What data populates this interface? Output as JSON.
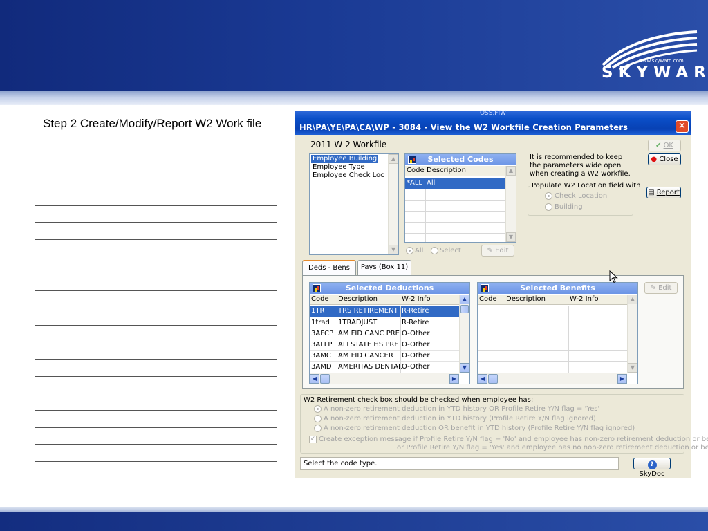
{
  "logo": {
    "url": "www.skyward.com",
    "word": "SKYWARD",
    "reg": "®"
  },
  "slide": {
    "step_text": "Step 2 Create/Modify/Report W2 Work file"
  },
  "window": {
    "top_caption": "OSS.FIW",
    "title": "HR\\PA\\YE\\PA\\CA\\WP - 3084 - View the W2 Workfile Creation Parameters",
    "close": "✕",
    "heading": "2011 W-2 Workfile",
    "type_list": [
      "Employee Building",
      "Employee Type",
      "Employee Check Loc"
    ],
    "codes": {
      "title": "Selected Codes",
      "columns": [
        "Code",
        "Description"
      ],
      "rows": [
        {
          "code": "*ALL",
          "desc": "All"
        }
      ],
      "radio_all": "All",
      "radio_select": "Select",
      "edit": "Edit"
    },
    "recommend": [
      "It is recommended to keep",
      "the parameters wide open",
      "when creating a W2 workfile."
    ],
    "populate": {
      "title": "Populate W2 Location field with",
      "opt1": "Check Location",
      "opt2": "Building"
    },
    "buttons": {
      "ok": "OK",
      "close": "Close",
      "report": "Report"
    },
    "tabs": [
      "Deds - Bens",
      "Pays (Box 11)"
    ],
    "deductions": {
      "title": "Selected Deductions",
      "columns": [
        "Code",
        "Description",
        "W-2 Info"
      ],
      "rows": [
        {
          "code": "1TR",
          "desc": "TRS RETIREMENT",
          "info": "R-Retire"
        },
        {
          "code": "1trad",
          "desc": "1TRADJUST",
          "info": "R-Retire"
        },
        {
          "code": "3AFCP",
          "desc": "AM FID CANC PRE",
          "info": "O-Other"
        },
        {
          "code": "3ALLP",
          "desc": "ALLSTATE HS PRE",
          "info": "O-Other"
        },
        {
          "code": "3AMC",
          "desc": "AM FID CANCER",
          "info": "O-Other"
        },
        {
          "code": "3AMD",
          "desc": "AMERITAS DENTAL",
          "info": "O-Other"
        }
      ]
    },
    "benefits": {
      "title": "Selected Benefits",
      "columns": [
        "Code",
        "Description",
        "W-2 Info"
      ],
      "edit": "Edit"
    },
    "retirement": {
      "title": "W2 Retirement check box should be checked when employee has:",
      "options": [
        "A non-zero retirement deduction in YTD history OR Profile Retire Y/N flag = 'Yes'",
        "A non-zero retirement deduction in YTD history (Profile Retire Y/N flag ignored)",
        "A non-zero retirement deduction OR benefit in YTD history (Profile Retire Y/N flag ignored)"
      ],
      "exception_1": "Create exception message  if Profile Retire Y/N flag = 'No'  and employee has non-zero retirement deduction or benefit",
      "exception_2": "or Profile Retire Y/N flag = 'Yes' and employee has no non-zero retirement deduction or benefit"
    },
    "status": "Select the code type.",
    "skydoc": "SkyDoc"
  },
  "colors": {
    "title_bar": "#0841b4",
    "selection": "#316ac5",
    "panel_head": "#7ca2ea",
    "slide_blue": "#1a3a94"
  }
}
